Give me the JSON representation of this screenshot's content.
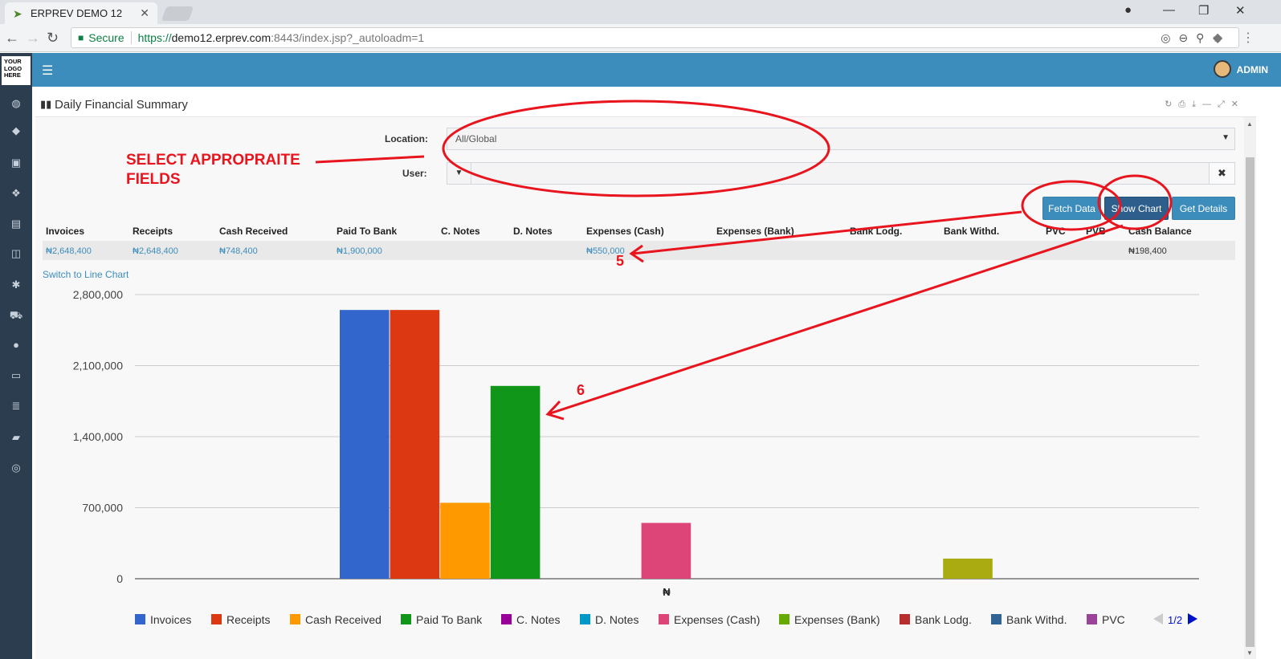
{
  "browser": {
    "tab_title": "ERPREV DEMO 12",
    "secure_label": "Secure",
    "url_scheme": "https://",
    "url_host": "demo12.erprev.com",
    "url_rest": ":8443/index.jsp?_autoloadm=1"
  },
  "app": {
    "logo_text": [
      "YOUR",
      "LOGO",
      "HERE"
    ],
    "user_name": "ADMIN",
    "brand_color": "#3c8dbc",
    "sidebar_color": "#2b3d4f",
    "sidebar_icons": [
      "dashboard-icon",
      "tag-icon",
      "money-icon",
      "cubes-icon",
      "building-icon",
      "archive-icon",
      "snowflake-icon",
      "cart-icon",
      "circle-icon",
      "monitor-icon",
      "database-icon",
      "book-icon",
      "lifebuoy-icon"
    ]
  },
  "panel": {
    "title": "Daily Financial Summary",
    "location_label": "Location:",
    "location_value": "All/Global",
    "user_label": "User:",
    "user_value": "",
    "buttons": {
      "fetch": "Fetch Data",
      "show_chart": "Show Chart",
      "details": "Get Details"
    },
    "table": {
      "headers": [
        "Invoices",
        "Receipts",
        "Cash Received",
        "Paid To Bank",
        "C. Notes",
        "D. Notes",
        "Expenses (Cash)",
        "Expenses (Bank)",
        "Bank Lodg.",
        "Bank Withd.",
        "PVC",
        "PVB",
        "Cash Balance"
      ],
      "values": [
        "₦2,648,400",
        "₦2,648,400",
        "₦748,400",
        "₦1,900,000",
        "",
        "",
        "₦550,000",
        "",
        "",
        "",
        "",
        "",
        "₦198,400"
      ]
    },
    "switch_link": "Switch to Line Chart"
  },
  "annotations": {
    "select_text": [
      "SELECT APPROPRAITE",
      "FIELDS"
    ],
    "label_5": "5",
    "label_6": "6",
    "color": "#e8141e"
  },
  "chart_data": {
    "type": "bar",
    "x_label": "₦",
    "ylim": [
      0,
      2800000
    ],
    "y_ticks": [
      "2,800,000",
      "2,100,000",
      "1,400,000",
      "700,000",
      "0"
    ],
    "legend_page": "1/2",
    "series": [
      {
        "name": "Invoices",
        "value": 2648400,
        "color": "#3366cc"
      },
      {
        "name": "Receipts",
        "value": 2648400,
        "color": "#dc3912"
      },
      {
        "name": "Cash Received",
        "value": 748400,
        "color": "#ff9900"
      },
      {
        "name": "Paid To Bank",
        "value": 1900000,
        "color": "#109618"
      },
      {
        "name": "C. Notes",
        "value": 0,
        "color": "#990099"
      },
      {
        "name": "D. Notes",
        "value": 0,
        "color": "#0099c6"
      },
      {
        "name": "Expenses (Cash)",
        "value": 550000,
        "color": "#dd4477"
      },
      {
        "name": "Expenses (Bank)",
        "value": 0,
        "color": "#66aa00"
      },
      {
        "name": "Bank Lodg.",
        "value": 0,
        "color": "#b82e2e"
      },
      {
        "name": "Bank Withd.",
        "value": 0,
        "color": "#316395"
      },
      {
        "name": "PVC",
        "value": 0,
        "color": "#994499"
      },
      {
        "name": "PVB",
        "value": 0,
        "color": "#22aa99"
      },
      {
        "name": "Cash Balance",
        "value": 198400,
        "color": "#aaaa11"
      }
    ]
  }
}
